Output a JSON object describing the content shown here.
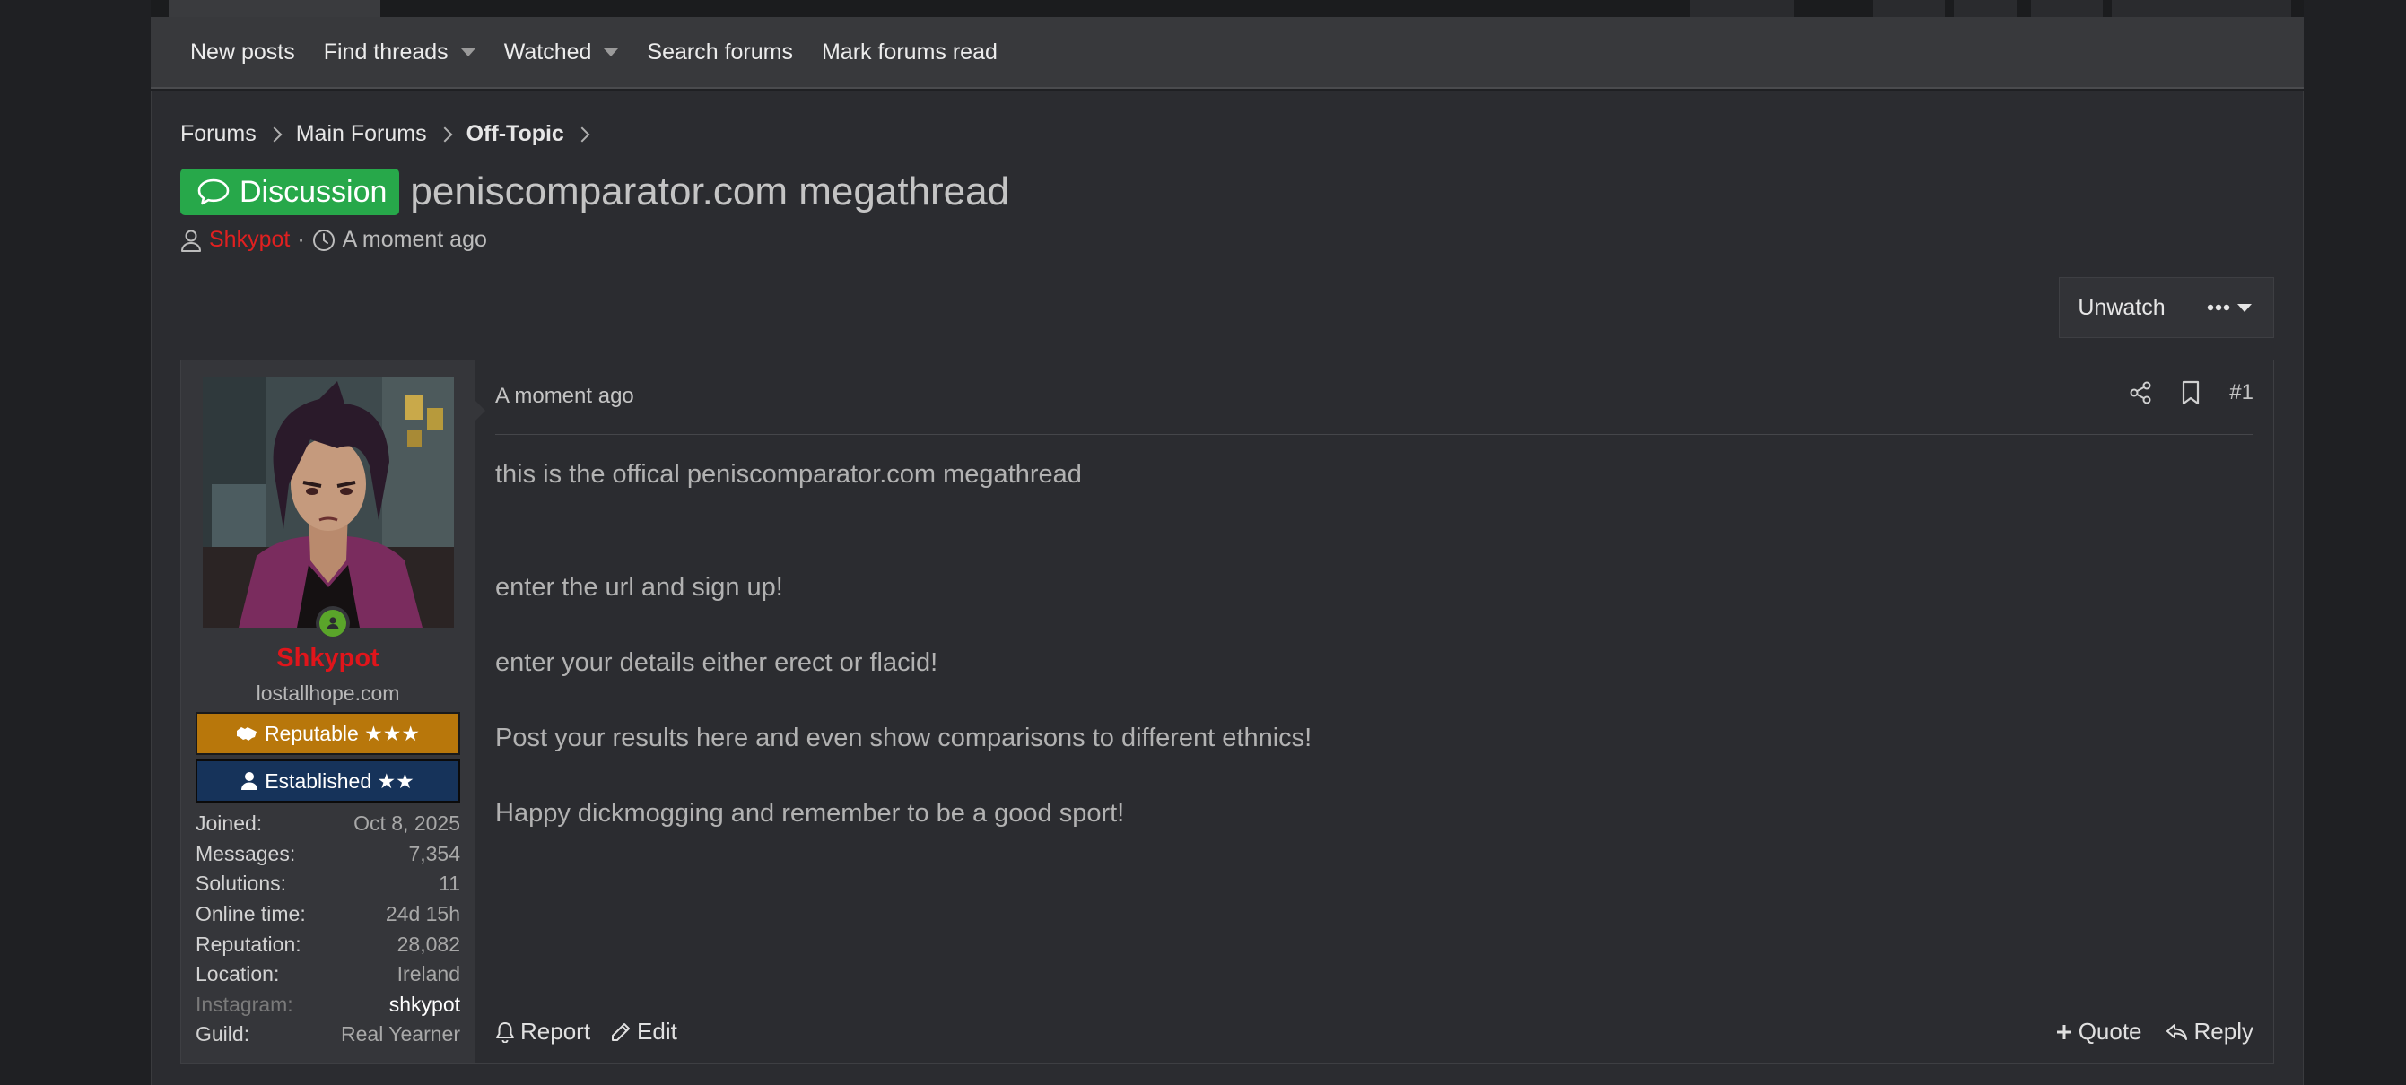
{
  "subnav": {
    "items": [
      {
        "label": "New posts",
        "dropdown": false
      },
      {
        "label": "Find threads",
        "dropdown": true
      },
      {
        "label": "Watched",
        "dropdown": true
      },
      {
        "label": "Search forums",
        "dropdown": false
      },
      {
        "label": "Mark forums read",
        "dropdown": false
      }
    ]
  },
  "breadcrumb": [
    "Forums",
    "Main Forums",
    "Off-Topic"
  ],
  "thread": {
    "prefix": "Discussion",
    "prefix_color": "#27a84a",
    "title": "peniscomparator.com megathread",
    "author": "Shkypot",
    "age": "A moment ago"
  },
  "thread_actions": {
    "unwatch": "Unwatch",
    "more_icon": "ellipsis-icon"
  },
  "post": {
    "user": {
      "name": "Shkypot",
      "name_color": "#e0151b",
      "title": "lostallhope.com",
      "banners": [
        {
          "label": "Reputable ★★★",
          "icon": "handshake-icon",
          "color": "#b8770b"
        },
        {
          "label": "Established ★★",
          "icon": "user-icon",
          "color": "#16335a"
        }
      ],
      "stats": [
        {
          "key": "Joined:",
          "value": "Oct 8, 2025"
        },
        {
          "key": "Messages:",
          "value": "7,354"
        },
        {
          "key": "Solutions:",
          "value": "11"
        },
        {
          "key": "Online time:",
          "value": "24d 15h"
        },
        {
          "key": "Reputation:",
          "value": "28,082"
        },
        {
          "key": "Location:",
          "value": "Ireland"
        },
        {
          "key": "Instagram:",
          "value": "shkypot"
        },
        {
          "key": "Guild:",
          "value": "Real Yearner"
        }
      ]
    },
    "date": "A moment ago",
    "number": "#1",
    "body": [
      "this is the offical peniscomparator.com megathread",
      "enter the url and sign up!",
      "enter your details either erect or flacid!",
      "Post your results here and even show comparisons to different ethnics!",
      "Happy dickmogging and remember to be a good sport!"
    ],
    "actions_left": [
      "Report",
      "Edit"
    ],
    "actions_right": [
      "Quote",
      "Reply"
    ]
  }
}
